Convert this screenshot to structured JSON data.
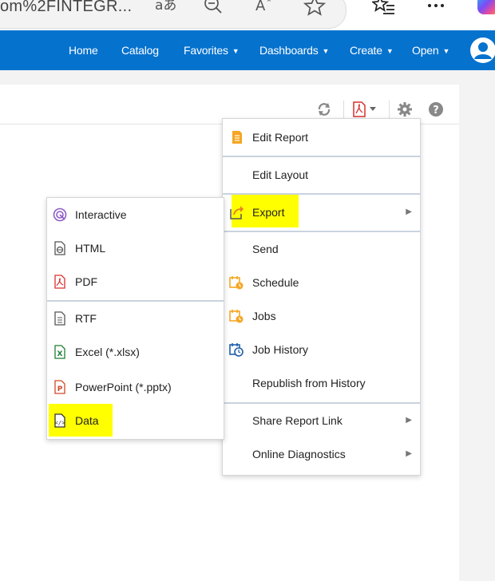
{
  "browser": {
    "url_text": "om%2FINTEGR...",
    "icons": [
      "read-aloud-icon",
      "zoom-out-icon",
      "text-size-icon",
      "favorite-icon",
      "favorites-list-icon",
      "more-icon",
      "copilot-icon"
    ]
  },
  "nav": {
    "home": "Home",
    "catalog": "Catalog",
    "favorites": "Favorites",
    "dashboards": "Dashboards",
    "create": "Create",
    "open": "Open",
    "caret": "▼"
  },
  "toolbar": {
    "icons": [
      "refresh-icon",
      "pdf-export-icon",
      "settings-icon",
      "help-icon"
    ]
  },
  "main_menu": {
    "items": [
      {
        "label": "Edit Report",
        "icon": "report-edit-icon"
      },
      {
        "label": "Edit Layout",
        "icon": ""
      },
      {
        "label": "Export",
        "icon": "export-icon",
        "submenu": true
      },
      {
        "label": "Send",
        "icon": ""
      },
      {
        "label": "Schedule",
        "icon": "schedule-icon"
      },
      {
        "label": "Jobs",
        "icon": "jobs-icon"
      },
      {
        "label": "Job History",
        "icon": "job-history-icon"
      },
      {
        "label": "Republish from History",
        "icon": ""
      },
      {
        "label": "Share Report Link",
        "icon": "",
        "submenu": true
      },
      {
        "label": "Online Diagnostics",
        "icon": "",
        "submenu": true
      }
    ],
    "arrow": "▶"
  },
  "export_submenu": {
    "items": [
      {
        "label": "Interactive",
        "icon": "interactive-icon"
      },
      {
        "label": "HTML",
        "icon": "html-file-icon"
      },
      {
        "label": "PDF",
        "icon": "pdf-file-icon"
      },
      {
        "label": "RTF",
        "icon": "rtf-file-icon"
      },
      {
        "label": "Excel (*.xlsx)",
        "icon": "excel-file-icon"
      },
      {
        "label": "PowerPoint (*.pptx)",
        "icon": "powerpoint-file-icon"
      },
      {
        "label": "Data",
        "icon": "data-file-icon"
      }
    ]
  },
  "colors": {
    "nav_bg": "#0572ce",
    "highlight": "#ffff00",
    "schedule_orange": "#f5a623",
    "pdf_red": "#d9302c",
    "excel_green": "#1e7e34",
    "interactive_purple": "#8e5cc7"
  }
}
